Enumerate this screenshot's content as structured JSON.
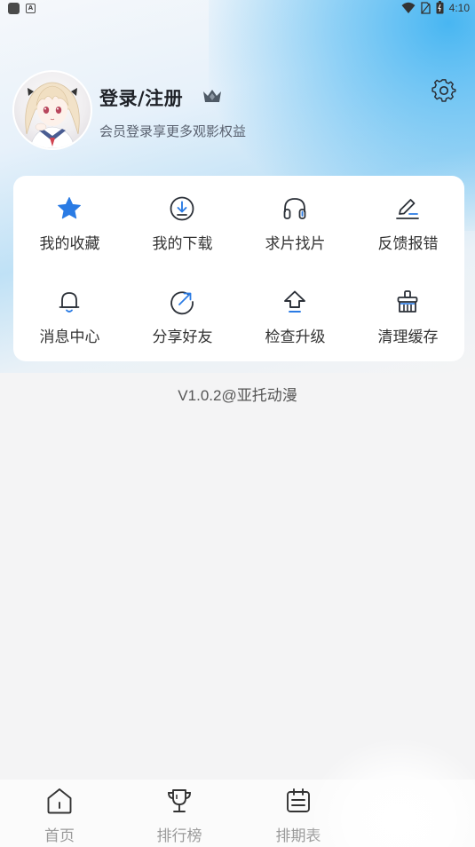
{
  "status_bar": {
    "time": "4:10"
  },
  "profile": {
    "title": "登录/注册",
    "subtitle": "会员登录享更多观影权益"
  },
  "menu": {
    "items": [
      {
        "label": "我的收藏",
        "icon": "star-icon"
      },
      {
        "label": "我的下载",
        "icon": "download-icon"
      },
      {
        "label": "求片找片",
        "icon": "headphones-icon"
      },
      {
        "label": "反馈报错",
        "icon": "edit-icon"
      },
      {
        "label": "消息中心",
        "icon": "bell-icon"
      },
      {
        "label": "分享好友",
        "icon": "share-icon"
      },
      {
        "label": "检查升级",
        "icon": "upgrade-icon"
      },
      {
        "label": "清理缓存",
        "icon": "broom-icon"
      }
    ]
  },
  "version": "V1.0.2@亚托动漫",
  "bottom_nav": {
    "items": [
      {
        "label": "首页",
        "icon": "home-icon"
      },
      {
        "label": "排行榜",
        "icon": "trophy-icon"
      },
      {
        "label": "排期表",
        "icon": "calendar-icon"
      }
    ]
  },
  "colors": {
    "accent": "#2a7be4",
    "icon_dark": "#2b3038",
    "text_muted": "#9a9a9a"
  }
}
